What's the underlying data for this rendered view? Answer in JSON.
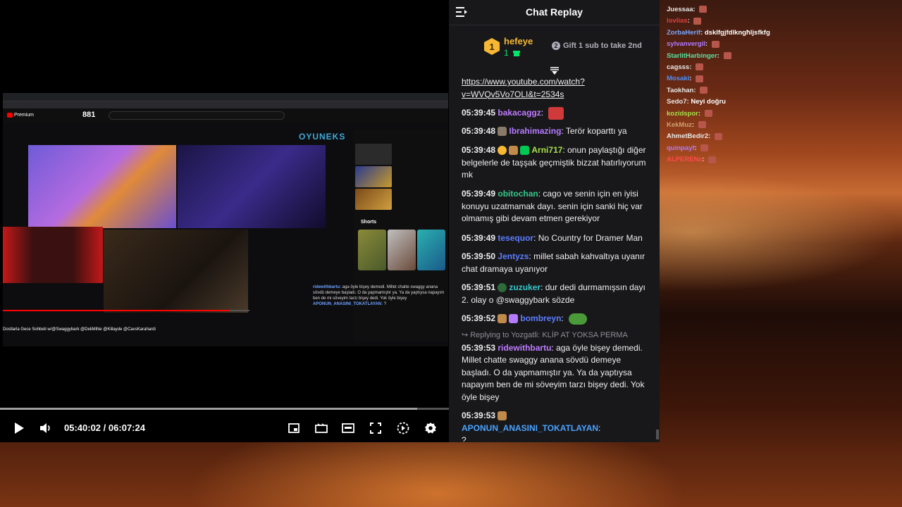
{
  "colors": {
    "chat_bg": "#18181b",
    "seek_played": "#00c853",
    "gold": "#f7b733"
  },
  "player": {
    "current_time": "05:40:02",
    "separator": "/",
    "duration": "06:07:24",
    "played_fraction": 0.88,
    "buffered_fraction": 0.93,
    "icons": [
      "play-icon",
      "volume-icon",
      "miniplayer-icon",
      "theater-icon",
      "pip-icon",
      "fullscreen-icon",
      "speed-icon",
      "settings-icon"
    ]
  },
  "video_frame": {
    "viewer_count": "881",
    "brand": "OYUNEKS",
    "youtube_premium": "Premium",
    "shorts_label": "Shorts",
    "video_title": "Dostlarla Gece Sohbeti w/@Swaggybark @DeliMiNe @Killayde @CavsKarahardi",
    "overlay_lines": [
      {
        "user": "ridewithbartu:",
        "text": "aga öyle bişey demedi. Millet chatte swaggy anana sövdü demeye başladı. O da yapmamıştır ya. Ya da yaptıysa napayım ben de mi söveyim tarzı bişey dedi. Yok öyle bişey"
      },
      {
        "user": "APONUN_ANASINI_TOKATLAYAN:",
        "text": "?"
      }
    ]
  },
  "chat": {
    "title": "Chat Replay",
    "pinned": {
      "rank": "1",
      "username": "hefeye",
      "gift_count": "1",
      "gift_rank_badge": "2",
      "gift_text": "Gift 1 sub to take 2nd"
    },
    "messages": [
      {
        "link": "https://www.youtube.com/watch?v=WVQv5Vo7OLI&t=2534s"
      },
      {
        "time": "05:39:45",
        "user": "bakacaggz",
        "color": "#bf7bff",
        "text": ""
      },
      {
        "time": "05:39:48",
        "user": "Ibrahimazing",
        "color": "#b57bff",
        "text": "Terör kopart­tı ya"
      },
      {
        "time": "05:39:48",
        "user": "Arni717",
        "color": "#a8e04a",
        "text": "onun paylaştığı diğer belgelerle de taşşak geçmiştik bizzat hatırlıyorum mk"
      },
      {
        "time": "05:39:49",
        "user": "obitochan",
        "color": "#35c88a",
        "text": "cago ve senin için en iyisi konuyu uzatmamak dayı. senin için sanki hiç var olmamış gibi devam etmen gerekiyor"
      },
      {
        "time": "05:39:49",
        "user": "tesequor",
        "color": "#5d7dff",
        "text": "No Country for Dramer Man"
      },
      {
        "time": "05:39:50",
        "user": "Jentyzs",
        "color": "#5d7dff",
        "text": "millet sabah kahvaltıya uyanır chat dramaya uyanıyor"
      },
      {
        "time": "05:39:51",
        "user": "zuzuker",
        "color": "#35c8c8",
        "text": "dur dedi durmamışsın dayı 2. olay o @swaggybark sözde"
      },
      {
        "time": "05:39:52",
        "user": "bombreyn",
        "color": "#5d7dff",
        "text": ""
      },
      {
        "reply": "Replying to Yozgatli: KLİP AT YOKSA PERMA",
        "time": "05:39:53",
        "user": "ridewithbartu",
        "color": "#bf7bff",
        "text": "aga öyle bişey demedi. Millet chatte swaggy anana sövdü demeye başladı. O da yapmamıştır ya. Ya da yaptıysa napayım ben de mi söveyim tarzı bişey dedi. Yok öyle bişey"
      },
      {
        "time": "05:39:53",
        "user": "APONUN_ANASINI_TOKATLAYAN",
        "color": "#4aa3ff",
        "text": "?"
      }
    ]
  },
  "overlay_chat": [
    {
      "user": "Juessaa",
      "color": "#e8e8e8",
      "text": ""
    },
    {
      "user": "lovlias",
      "color": "#e04040",
      "text": ""
    },
    {
      "user": "ZorbaHerif",
      "color": "#7aa8ff",
      "text": "dsklfgjfdlkngħljsfkfg"
    },
    {
      "user": "sylvanvergil",
      "color": "#b07bff",
      "text": ""
    },
    {
      "user": "StarlitHarbinger",
      "color": "#5ae0a0",
      "text": ""
    },
    {
      "user": "cagsss",
      "color": "#e8e8e8",
      "text": ""
    },
    {
      "user": "Mosaki",
      "color": "#4a90ff",
      "text": ""
    },
    {
      "user": "Taokhan",
      "color": "#e8e8e8",
      "text": ""
    },
    {
      "user": "Sedo7",
      "color": "#e8e8e8",
      "text": "Neyi doğru"
    },
    {
      "user": "kozidspor",
      "color": "#a8e04a",
      "text": ""
    },
    {
      "user": "KekMuz",
      "color": "#d0a070",
      "text": ""
    },
    {
      "user": "AhmetBedir2",
      "color": "#e8e8e8",
      "text": ""
    },
    {
      "user": "quinpayf",
      "color": "#b07bff",
      "text": ""
    },
    {
      "user": "ALPERENz",
      "color": "#ff4a4a",
      "text": ""
    }
  ]
}
